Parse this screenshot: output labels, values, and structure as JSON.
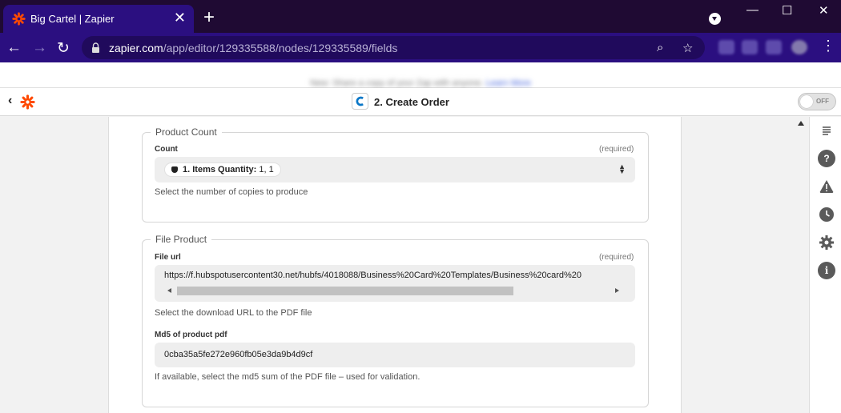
{
  "browser": {
    "tab_title": "Big Cartel | Zapier",
    "tab_close": "✕",
    "new_tab": "+",
    "url_host": "zapier.com",
    "url_path": "/app/editor/129335588/nodes/129335589/fields",
    "window_controls": [
      "—",
      "☐",
      "✕"
    ]
  },
  "banner": {
    "text": "New: Share a copy of your Zap with anyone.",
    "link": "Learn More"
  },
  "header": {
    "back": "‹",
    "step_title": "2. Create Order",
    "toggle_label": "OFF"
  },
  "sections": {
    "product_count": {
      "legend": "Product Count",
      "field_label": "Count",
      "required": "(required)",
      "pill_key": "1. Items Quantity:",
      "pill_value": "1, 1",
      "help": "Select the number of copies to produce"
    },
    "file_product": {
      "legend": "File Product",
      "url_label": "File url",
      "url_required": "(required)",
      "url_value": "https://f.hubspotusercontent30.net/hubfs/4018088/Business%20Card%20Templates/Business%20card%20",
      "url_help": "Select the download URL to the PDF file",
      "md5_label": "Md5 of product pdf",
      "md5_value": "0cba35a5fe272e960fb05e3da9b4d9cf",
      "md5_help": "If available, select the md5 sum of the PDF file – used for validation."
    }
  },
  "sidebar_icons": [
    "outline-icon",
    "help-icon",
    "warning-icon",
    "history-icon",
    "settings-icon",
    "info-icon"
  ],
  "colors": {
    "browser_frame": "#2b0f80",
    "tabbar": "#1f0a33",
    "zapier_orange": "#ff4a00"
  }
}
